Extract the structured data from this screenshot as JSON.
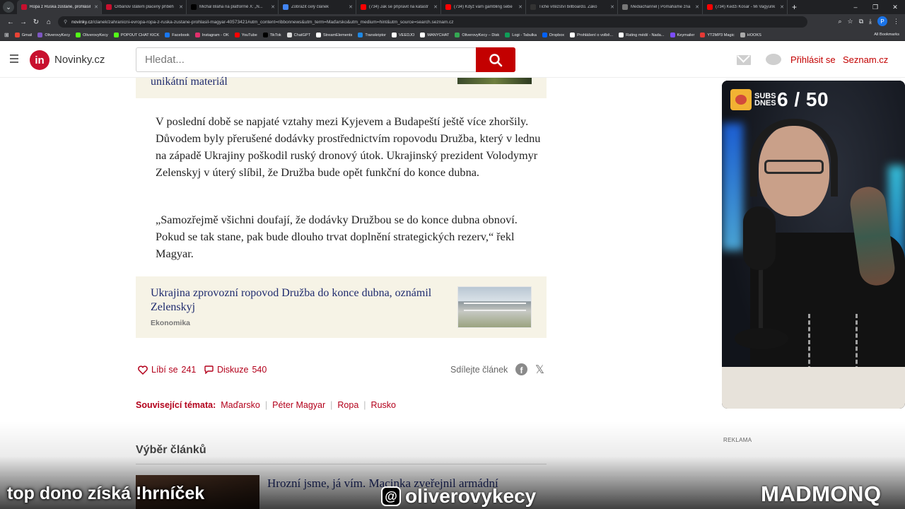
{
  "browser": {
    "tabs": [
      {
        "label": "Ropa z Ruska zůstane, prohlásil",
        "active": true,
        "color": "#c8102e"
      },
      {
        "label": "Orbánův státem placený příběh",
        "active": false,
        "color": "#c8102e"
      },
      {
        "label": "Michal Bláha na platformě X: „N...",
        "active": false,
        "color": "#000000"
      },
      {
        "label": "Zobrazit celý článek",
        "active": false,
        "color": "#4285f4"
      },
      {
        "label": "(734) Jak se připravit na katastr",
        "active": false,
        "color": "#ff0000"
      },
      {
        "label": "(734) Když vám gambling sebe",
        "active": false,
        "color": "#ff0000"
      },
      {
        "label": "Tiché vítězství billboardů. Záko",
        "active": false,
        "color": "#333333"
      },
      {
        "label": "Mediachannel | Pomáháme zna",
        "active": false,
        "color": "#777777"
      },
      {
        "label": "(734) Kedži Kosár - Mi Vagyunk",
        "active": false,
        "color": "#ff0000"
      }
    ],
    "url_host": "novinky.cz",
    "url_rest": "/clanek/zahranicni-evropa-ropa-z-ruska-zustane-prohlasil-magyar-40573421#utm_content=ribbonnews&utm_term=Maďarsko&utm_medium=hint&utm_source=search.seznam.cz",
    "bookmarks": [
      {
        "label": "Gmail",
        "color": "#ea4335"
      },
      {
        "label": "OliverovyKecy",
        "color": "#7e57c2"
      },
      {
        "label": "OliverovyKecy",
        "color": "#53fc18"
      },
      {
        "label": "POPOUT CHAT KICK",
        "color": "#53fc18"
      },
      {
        "label": "Facebook",
        "color": "#1877f2"
      },
      {
        "label": "Instagram - OK",
        "color": "#e1306c"
      },
      {
        "label": "YouTube",
        "color": "#ff0000"
      },
      {
        "label": "TikTok",
        "color": "#000000"
      },
      {
        "label": "ChatGPT",
        "color": "#dddddd"
      },
      {
        "label": "StreamElements",
        "color": "#ffffff"
      },
      {
        "label": "Transkriptor",
        "color": "#1e88e5"
      },
      {
        "label": "VEEDJO",
        "color": "#ffffff"
      },
      {
        "label": "MANYCHAT",
        "color": "#ffffff"
      },
      {
        "label": "OliverovyKecy – Disk",
        "color": "#34a853"
      },
      {
        "label": "Logi - Tabulka",
        "color": "#0f9d58"
      },
      {
        "label": "Dropbox",
        "color": "#0061ff"
      },
      {
        "label": "Prohlášení o volbě...",
        "color": "#ffffff"
      },
      {
        "label": "Rating médií - Nada...",
        "color": "#ffffff"
      },
      {
        "label": "Keymailer",
        "color": "#7c4dff"
      },
      {
        "label": "YT2MP3 Magic",
        "color": "#e53935"
      },
      {
        "label": "HOOKS",
        "color": "#aaaaaa"
      }
    ],
    "all_bookmarks": "All Bookmarks",
    "profile_initial": "P"
  },
  "header": {
    "logo_badge": "in",
    "logo_text": "Novinky.cz",
    "search_placeholder": "Hledat...",
    "login": "Přihlásit se",
    "seznam": "Seznam.cz"
  },
  "article": {
    "teaser_top_title": "unikátní materiál",
    "paragraph1": "V poslední době se napjaté vztahy mezi Kyjevem a Budapeští ještě více zhoršily. Důvodem byly přerušené dodávky prostřednictvím ropovodu Družba, který v lednu na západě Ukrajiny poškodil ruský dronový útok. Ukrajinský prezident Volodymyr Zelenskyj v úterý slíbil, že Družba bude opět funkční do konce dubna.",
    "paragraph2": "„Samozřejmě všichni doufají, že dodávky Družbou se do konce dubna obnoví. Pokud se tak stane, pak bude dlouho trvat doplnění strategických rezerv,“ řekl Magyar.",
    "teaser": {
      "title": "Ukrajina zprovozní ropovod Družba do konce dubna, oznámil Zelenskyj",
      "category": "Ekonomika"
    },
    "likes_label": "Líbí se",
    "likes_count": "241",
    "comments_label": "Diskuze",
    "comments_count": "540",
    "share_label": "Sdílejte článek",
    "related_label": "Související témata:",
    "related_tags": [
      "Maďarsko",
      "Péter Magyar",
      "Ropa",
      "Rusko"
    ],
    "section_title": "Výběr článků",
    "next_title": "Hrozní jsme, já vím. Macinka zveřejnil armádní",
    "ad_label": "REKLAMA"
  },
  "stream_overlay": {
    "subs_label": "SUBS DNES",
    "subs_count": "6 / 50",
    "left_text": "top dono získá !hrníček",
    "handle": "oliverovykecy",
    "brand": "MADMONQ"
  },
  "colors": {
    "brand_red": "#c30000",
    "link_red": "#b3001b",
    "teaser_bg": "#f6f3e6",
    "teaser_title": "#1f2b6e"
  }
}
